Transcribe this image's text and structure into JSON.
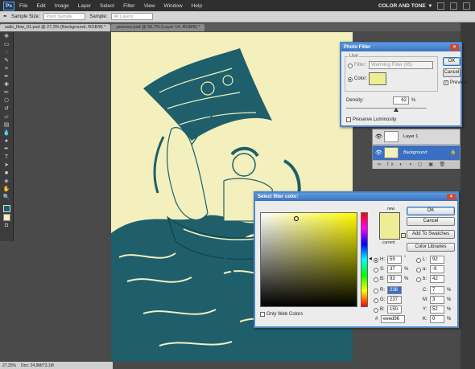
{
  "menubar": {
    "logo": "Ps",
    "items": [
      "File",
      "Edit",
      "Image",
      "Layer",
      "Select",
      "Filter",
      "View",
      "Window",
      "Help"
    ],
    "workspace": "COLOR AND TONE"
  },
  "options": {
    "sample_size_label": "Sample Size:",
    "sample_size_value": "Point Sample",
    "sample_label": "Sample:",
    "sample_value": "All Layers"
  },
  "tabs": [
    {
      "label": "sails_flow_01.psd @ 27,3% (Background, RGB/8) *"
    },
    {
      "label": "pescreo.psd @ 66,7% (Layer 14, RGB/8) *"
    }
  ],
  "status": {
    "zoom": "27,25%",
    "doc": "Doc: 24,9M/73,1M"
  },
  "colors": {
    "canvas_bg": "#f3f0bd",
    "ink": "#1e5f6b",
    "dialog_blue": "#3a73c0"
  },
  "photo_filter": {
    "title": "Photo Filter",
    "use_label": "Use",
    "filter_label": "Filter:",
    "filter_value": "Warming Filter (85)",
    "color_label": "Color:",
    "color_swatch": "#eeed96",
    "density_label": "Density:",
    "density_value": "62",
    "density_unit": "%",
    "density_fraction": 0.62,
    "preserve_label": "Preserve Luminosity",
    "ok": "OK",
    "cancel": "Cancel",
    "preview_label": "Preview"
  },
  "layers": [
    {
      "name": "Layer 1"
    },
    {
      "name": "Background"
    }
  ],
  "color_picker": {
    "title": "Select filter color:",
    "new_label": "new",
    "current_label": "current",
    "ok": "OK",
    "cancel": "Cancel",
    "add_swatches": "Add To Swatches",
    "color_libraries": "Color Libraries",
    "only_web": "Only Web Colors",
    "hsb": [
      {
        "key": "H:",
        "value": "59",
        "unit": "°"
      },
      {
        "key": "S:",
        "value": "37",
        "unit": "%"
      },
      {
        "key": "B:",
        "value": "93",
        "unit": "%"
      }
    ],
    "rgb": [
      {
        "key": "R:",
        "value": "238"
      },
      {
        "key": "G:",
        "value": "237"
      },
      {
        "key": "B:",
        "value": "150"
      }
    ],
    "lab": [
      {
        "key": "L:",
        "value": "92"
      },
      {
        "key": "a:",
        "value": "-9"
      },
      {
        "key": "b:",
        "value": "42"
      }
    ],
    "cmyk": [
      {
        "key": "C:",
        "value": "7",
        "unit": "%"
      },
      {
        "key": "M:",
        "value": "3",
        "unit": "%"
      },
      {
        "key": "Y:",
        "value": "52",
        "unit": "%"
      },
      {
        "key": "K:",
        "value": "0",
        "unit": "%"
      }
    ],
    "hex_label": "#",
    "hex_value": "eeed96",
    "new_color": "#eeed96",
    "current_color": "#eeed96"
  }
}
